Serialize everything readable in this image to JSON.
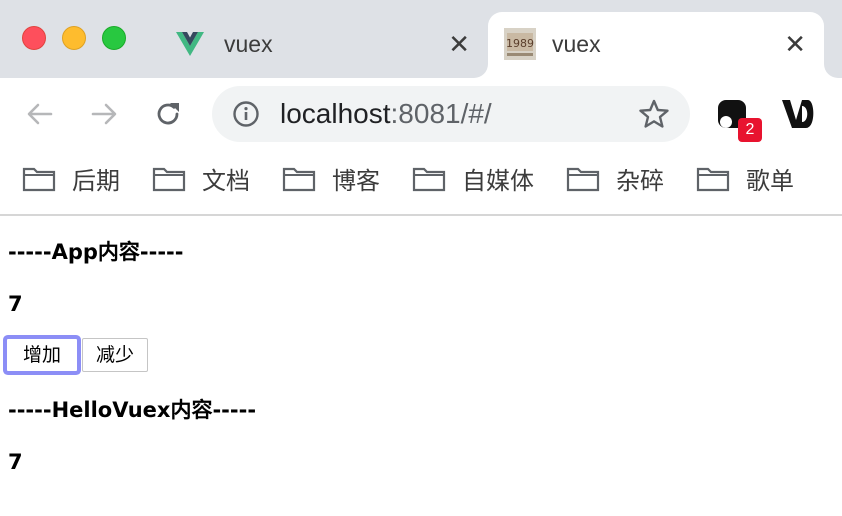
{
  "window": {
    "traffic_lights": [
      "close",
      "minimize",
      "zoom"
    ]
  },
  "tabs": [
    {
      "title": "vuex",
      "favicon": "vue-logo-icon",
      "close": "✕"
    },
    {
      "title": "vuex",
      "favicon": "album-cover-icon",
      "close": "✕"
    }
  ],
  "toolbar": {
    "back": "arrow-left-icon",
    "forward": "arrow-right-icon",
    "reload": "reload-icon",
    "url_host": "localhost",
    "url_rest": ":8081/#/",
    "extension_badge": "2"
  },
  "bookmarks": [
    {
      "label": "后期"
    },
    {
      "label": "文档"
    },
    {
      "label": "博客"
    },
    {
      "label": "自媒体"
    },
    {
      "label": "杂碎"
    },
    {
      "label": "歌单"
    }
  ],
  "page": {
    "app_heading": "-----App内容-----",
    "app_count": "7",
    "increment_label": "增加",
    "decrement_label": "减少",
    "hello_heading": "-----HelloVuex内容-----",
    "hello_count": "7"
  },
  "colors": {
    "tabstrip": "#dee1e6",
    "omnibox": "#f1f3f4",
    "focus_ring": "#8c8ef6",
    "badge": "#e8132f"
  }
}
